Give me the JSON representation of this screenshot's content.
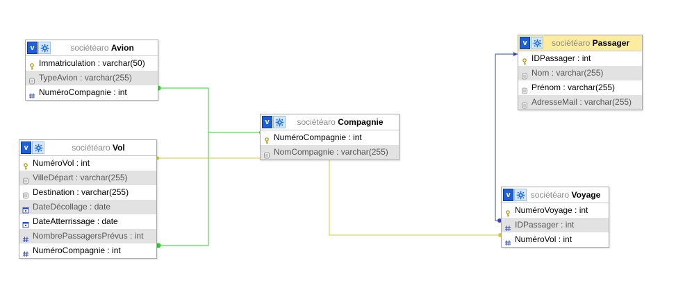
{
  "db_name": "sociétéaro",
  "tables": {
    "avion": {
      "name": "Avion",
      "columns": [
        {
          "label": "Immatriculation : varchar(50)",
          "icon": "key-icon"
        },
        {
          "label": "TypeAvion : varchar(255)",
          "icon": "field-icon"
        },
        {
          "label": "NuméroCompagnie : int",
          "icon": "number-icon"
        }
      ]
    },
    "vol": {
      "name": "Vol",
      "columns": [
        {
          "label": "NuméroVol : int",
          "icon": "key-icon"
        },
        {
          "label": "VilleDépart : varchar(255)",
          "icon": "field-icon"
        },
        {
          "label": "Destination : varchar(255)",
          "icon": "field-icon"
        },
        {
          "label": "DateDécollage : date",
          "icon": "date-icon"
        },
        {
          "label": "DateAtterrissage : date",
          "icon": "date-icon"
        },
        {
          "label": "NombrePassagersPrévus : int",
          "icon": "number-icon"
        },
        {
          "label": "NuméroCompagnie : int",
          "icon": "number-icon"
        }
      ]
    },
    "compagnie": {
      "name": "Compagnie",
      "columns": [
        {
          "label": "NuméroCompagnie : int",
          "icon": "key-icon"
        },
        {
          "label": "NomCompagnie : varchar(255)",
          "icon": "field-icon"
        }
      ]
    },
    "passager": {
      "name": "Passager",
      "columns": [
        {
          "label": "IDPassager : int",
          "icon": "key-icon"
        },
        {
          "label": "Nom : varchar(255)",
          "icon": "field-icon"
        },
        {
          "label": "Prénom : varchar(255)",
          "icon": "field-icon"
        },
        {
          "label": "AdresseMail : varchar(255)",
          "icon": "field-icon"
        }
      ]
    },
    "voyage": {
      "name": "Voyage",
      "columns": [
        {
          "label": "NuméroVoyage : int",
          "icon": "key-icon"
        },
        {
          "label": "IDPassager : int",
          "icon": "number-icon"
        },
        {
          "label": "NuméroVol : int",
          "icon": "number-icon"
        }
      ]
    }
  },
  "toggle_label": "v",
  "colors": {
    "link_compagnie": "#33cc33",
    "link_vol": "#cccc33",
    "link_passager": "#3344aa",
    "header_highlight": "#fbeca0",
    "toggle_blue": "#1f5fd6"
  }
}
